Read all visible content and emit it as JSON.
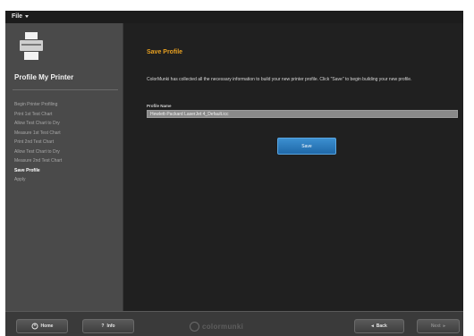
{
  "menubar": {
    "file_label": "File"
  },
  "sidebar": {
    "title": "Profile My Printer",
    "steps": [
      {
        "label": "Begin Printer Profiling",
        "active": false
      },
      {
        "label": "Print 1st Test Chart",
        "active": false
      },
      {
        "label": "Allow Test Chart to Dry",
        "active": false
      },
      {
        "label": "Measure 1st Test Chart",
        "active": false
      },
      {
        "label": "Print 2nd Test Chart",
        "active": false
      },
      {
        "label": "Allow Test Chart to Dry",
        "active": false
      },
      {
        "label": "Measure 2nd Test Chart",
        "active": false
      },
      {
        "label": "Save Profile",
        "active": true
      },
      {
        "label": "Apply",
        "active": false
      }
    ]
  },
  "main": {
    "title": "Save Profile",
    "description": "ColorMunki has collected all the necessary information to build your new printer profile. Click \"Save\" to begin building your new profile.",
    "profile_name_label": "Profile Name",
    "profile_name_value": "Hewlett-Packard LaserJet 4_Default.icc",
    "save_label": "Save"
  },
  "footer": {
    "home_label": "Home",
    "info_label": "Info",
    "brand": "colormunki",
    "back_label": "Back",
    "next_label": "Next"
  }
}
